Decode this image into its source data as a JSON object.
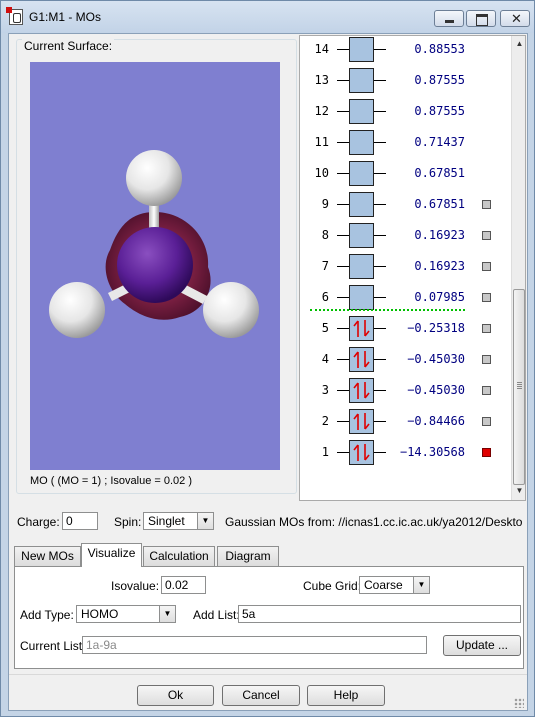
{
  "window": {
    "title": "G1:M1 - MOs"
  },
  "surface": {
    "group_label": "Current Surface:",
    "caption": "MO ( (MO = 1) ; Isovalue = 0.02 )"
  },
  "orbitals": [
    {
      "num": "14",
      "energy": "0.88553",
      "occupied": false,
      "selectable": false,
      "selected": false
    },
    {
      "num": "13",
      "energy": "0.87555",
      "occupied": false,
      "selectable": false,
      "selected": false
    },
    {
      "num": "12",
      "energy": "0.87555",
      "occupied": false,
      "selectable": false,
      "selected": false
    },
    {
      "num": "11",
      "energy": "0.71437",
      "occupied": false,
      "selectable": false,
      "selected": false
    },
    {
      "num": "10",
      "energy": "0.67851",
      "occupied": false,
      "selectable": false,
      "selected": false
    },
    {
      "num": "9",
      "energy": "0.67851",
      "occupied": false,
      "selectable": true,
      "selected": false
    },
    {
      "num": "8",
      "energy": "0.16923",
      "occupied": false,
      "selectable": true,
      "selected": false
    },
    {
      "num": "7",
      "energy": "0.16923",
      "occupied": false,
      "selectable": true,
      "selected": false
    },
    {
      "num": "6",
      "energy": "0.07985",
      "occupied": false,
      "selectable": true,
      "selected": false
    },
    {
      "num": "5",
      "energy": "−0.25318",
      "occupied": true,
      "selectable": true,
      "selected": false
    },
    {
      "num": "4",
      "energy": "−0.45030",
      "occupied": true,
      "selectable": true,
      "selected": false
    },
    {
      "num": "3",
      "energy": "−0.45030",
      "occupied": true,
      "selectable": true,
      "selected": false
    },
    {
      "num": "2",
      "energy": "−0.84466",
      "occupied": true,
      "selectable": true,
      "selected": false
    },
    {
      "num": "1",
      "energy": "−14.30568",
      "occupied": true,
      "selectable": true,
      "selected": true
    }
  ],
  "controls": {
    "charge_label": "Charge:",
    "charge_value": "0",
    "spin_label": "Spin:",
    "spin_value": "Singlet",
    "source_text": "Gaussian MOs from:  //icnas1.cc.ic.ac.uk/ya2012/Deskto"
  },
  "tabs": [
    {
      "label": "New MOs",
      "active": false
    },
    {
      "label": "Visualize",
      "active": true
    },
    {
      "label": "Calculation",
      "active": false
    },
    {
      "label": "Diagram",
      "active": false
    }
  ],
  "visualize": {
    "isovalue_label": "Isovalue:",
    "isovalue_value": "0.02",
    "cube_grid_label": "Cube Grid:",
    "cube_grid_value": "Coarse",
    "add_type_label": "Add Type:",
    "add_type_value": "HOMO",
    "add_list_label": "Add List:",
    "add_list_value": "5a",
    "current_list_label": "Current List:",
    "current_list_value": "1a-9a",
    "update_label": "Update ..."
  },
  "buttons": {
    "ok": "Ok",
    "cancel": "Cancel",
    "help": "Help"
  },
  "colors": {
    "viewport_bg": "#7f7fd0",
    "empty_orbital": "#a8c3e0",
    "energy_text": "#000080",
    "homo_lumo_separator": "#00c000",
    "selected_marker": "#e00000"
  }
}
